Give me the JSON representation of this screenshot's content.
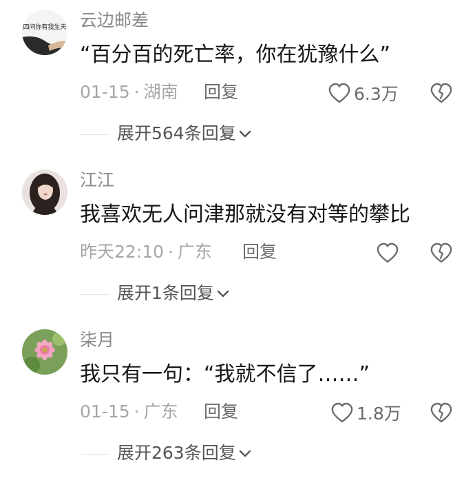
{
  "comments": [
    {
      "username": "云边邮差",
      "text": "“百分百的死亡率，你在犹豫什么”",
      "date": "01-15",
      "location": "湖南",
      "reply_label": "回复",
      "likes": "6.3万",
      "expand_label": "展开564条回复",
      "avatar_text": "人生四问你有我生天有由"
    },
    {
      "username": "江江",
      "text": "我喜欢无人问津那就没有对等的攀比",
      "date": "昨天22:10",
      "location": "广东",
      "reply_label": "回复",
      "likes": "",
      "expand_label": "展开1条回复"
    },
    {
      "username": "柒月",
      "text": "我只有一句：“我就不信了……”",
      "date": "01-15",
      "location": "广东",
      "reply_label": "回复",
      "likes": "1.8万",
      "expand_label": "展开263条回复"
    }
  ],
  "meta_separator": "·",
  "icons": {
    "like": "heart-outline-icon",
    "dislike": "broken-heart-icon",
    "expand": "chevron-down-icon"
  },
  "colors": {
    "username": "#8a8a8a",
    "text": "#161616",
    "meta": "#a6a6a6",
    "action": "#6b6b6b"
  }
}
